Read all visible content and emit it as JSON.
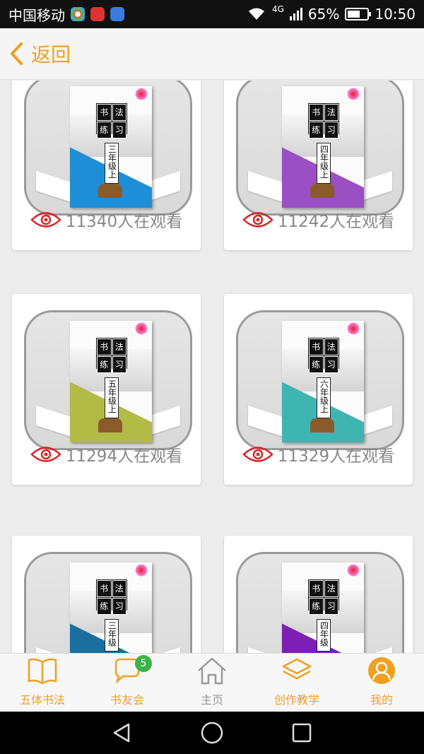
{
  "status_bar": {
    "carrier": "中国移动",
    "network": "4G",
    "battery": "65%",
    "battery_level": 0.65,
    "time": "10:50"
  },
  "header": {
    "back_label": "返回"
  },
  "books": [
    {
      "seal": [
        "书",
        "法",
        "练",
        "习"
      ],
      "grade": "三年级上",
      "color": "#1e8fd6",
      "viewers": "11340人在观看"
    },
    {
      "seal": [
        "书",
        "法",
        "练",
        "习"
      ],
      "grade": "四年级上",
      "color": "#9a4fc2",
      "viewers": "11242人在观看"
    },
    {
      "seal": [
        "书",
        "法",
        "练",
        "习"
      ],
      "grade": "五年级上",
      "color": "#b2bb45",
      "viewers": "11294人在观看"
    },
    {
      "seal": [
        "书",
        "法",
        "练",
        "习"
      ],
      "grade": "六年级上",
      "color": "#3fb5b2",
      "viewers": "11329人在观看"
    },
    {
      "seal": [
        "书",
        "法",
        "练",
        "习"
      ],
      "grade": "三年级",
      "color": "#1a6f9e",
      "viewers": ""
    },
    {
      "seal": [
        "书",
        "法",
        "练",
        "习"
      ],
      "grade": "四年级",
      "color": "#7b1fb5",
      "viewers": ""
    }
  ],
  "tabbar": {
    "items": [
      {
        "label": "五体书法",
        "icon": "book-icon",
        "active": true
      },
      {
        "label": "书友会",
        "icon": "chat-icon",
        "active": true,
        "badge": "5"
      },
      {
        "label": "主页",
        "icon": "home-icon",
        "active": false
      },
      {
        "label": "创作教学",
        "icon": "layers-icon",
        "active": true
      },
      {
        "label": "我的",
        "icon": "profile-icon",
        "active": true
      }
    ]
  },
  "colors": {
    "accent": "#f0a020",
    "eye": "#d9262a",
    "badge": "#3ab44a"
  }
}
